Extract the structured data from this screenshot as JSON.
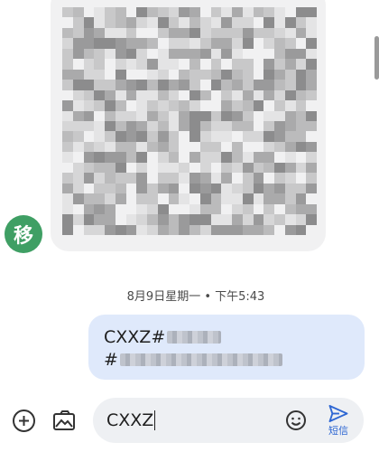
{
  "conversation": {
    "avatar_text": "移",
    "timestamp": "8月9日星期一 • 下午5:43",
    "outgoing_message": {
      "line1_prefix": "CXXZ#",
      "line2_prefix": "#"
    }
  },
  "compose": {
    "input_value": "CXXZ",
    "send_label": "短信"
  },
  "colors": {
    "avatar": "#3f9f64",
    "outgoing_bubble": "#dfe9fb",
    "incoming_bubble": "#f1f1f2",
    "send_accent": "#2e67d3"
  },
  "icons": [
    "add-circle-icon",
    "gallery-icon",
    "emoji-icon",
    "send-icon"
  ]
}
